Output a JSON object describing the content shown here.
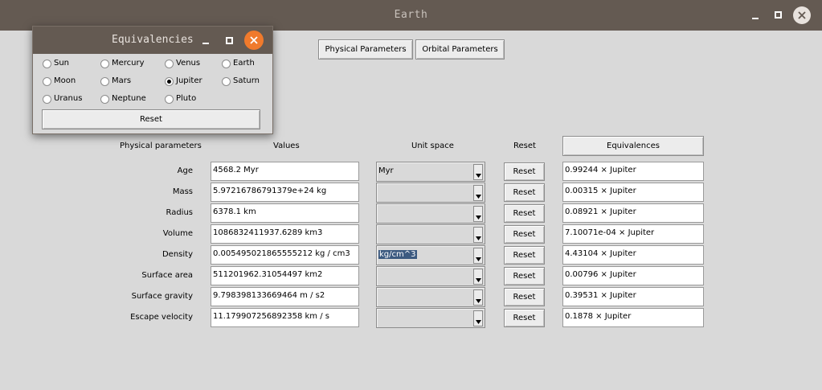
{
  "window": {
    "title": "Earth"
  },
  "top_buttons": {
    "physical": "Physical Parameters",
    "orbital": "Orbital Parameters"
  },
  "table": {
    "headers": {
      "params": "Physical parameters",
      "values": "Values",
      "unit_space": "Unit space",
      "reset": "Reset",
      "equivalences": "Equivalences"
    },
    "rows": [
      {
        "label": "Age",
        "value": "4568.2 Myr",
        "unit": "Myr",
        "reset": "Reset",
        "equiv": "0.99244 × Jupiter"
      },
      {
        "label": "Mass",
        "value": "5.97216786791379e+24 kg",
        "unit": "",
        "reset": "Reset",
        "equiv": "0.00315 × Jupiter"
      },
      {
        "label": "Radius",
        "value": "6378.1 km",
        "unit": "",
        "reset": "Reset",
        "equiv": "0.08921 × Jupiter"
      },
      {
        "label": "Volume",
        "value": "1086832411937.6289 km3",
        "unit": "",
        "reset": "Reset",
        "equiv": "7.10071e-04 × Jupiter"
      },
      {
        "label": "Density",
        "value": "0.005495021865555212 kg / cm3",
        "unit": "kg/cm^3",
        "reset": "Reset",
        "equiv": "4.43104 × Jupiter"
      },
      {
        "label": "Surface area",
        "value": "511201962.31054497 km2",
        "unit": "",
        "reset": "Reset",
        "equiv": "0.00796 × Jupiter"
      },
      {
        "label": "Surface gravity",
        "value": "9.798398133669464 m / s2",
        "unit": "",
        "reset": "Reset",
        "equiv": "0.39531 × Jupiter"
      },
      {
        "label": "Escape velocity",
        "value": "11.179907256892358 km / s",
        "unit": "",
        "reset": "Reset",
        "equiv": "0.1878 × Jupiter"
      }
    ]
  },
  "dialog": {
    "title": "Equivalencies",
    "options": [
      "Sun",
      "Mercury",
      "Venus",
      "Earth",
      "Moon",
      "Mars",
      "Jupiter",
      "Saturn",
      "Uranus",
      "Neptune",
      "Pluto"
    ],
    "selected": "Jupiter",
    "reset": "Reset"
  },
  "colors": {
    "titlebar": "#645a52",
    "close_accent": "#f07a2c",
    "selection": "#3c5a80",
    "background": "#d9d9d9"
  }
}
